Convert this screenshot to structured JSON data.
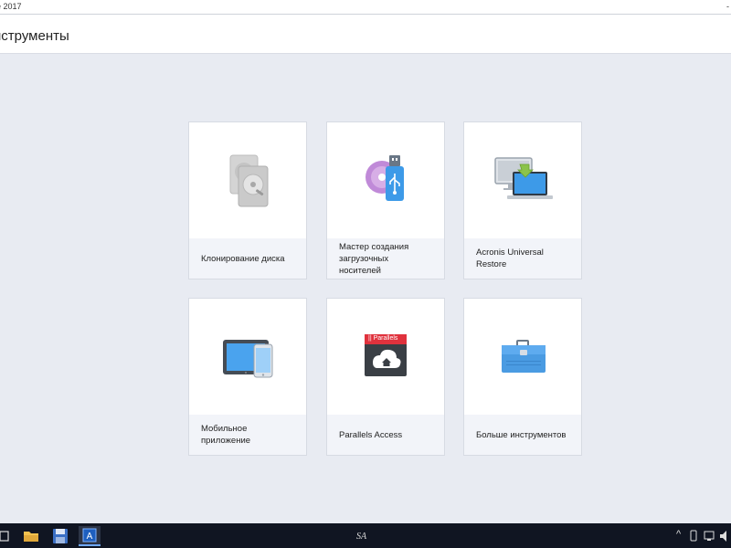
{
  "window": {
    "title": "e 2017",
    "edge_glyph": "-"
  },
  "header": {
    "title": "нструменты"
  },
  "tiles": [
    {
      "label": "Клонирование диска",
      "icon": "hard-disks-icon"
    },
    {
      "label": "Мастер создания загрузочных носителей",
      "icon": "usb-disc-icon"
    },
    {
      "label": "Acronis Universal Restore",
      "icon": "monitor-laptop-icon"
    },
    {
      "label": "Мобильное приложение",
      "icon": "tablet-phone-icon"
    },
    {
      "label": "Parallels Access",
      "icon": "parallels-icon",
      "brand_text": "|| Parallels"
    },
    {
      "label": "Больше инструментов",
      "icon": "toolbox-icon"
    }
  ],
  "taskbar": {
    "center_text": "SA",
    "tray_arrow": "^",
    "icons": [
      "task-view-icon",
      "file-explorer-icon",
      "save-disk-icon",
      "acronis-app-icon"
    ]
  },
  "colors": {
    "background": "#e8ebf2",
    "tile": "#ffffff",
    "label_band": "#f2f4f9",
    "accent_blue": "#3d9ae8",
    "taskbar": "#101522"
  }
}
